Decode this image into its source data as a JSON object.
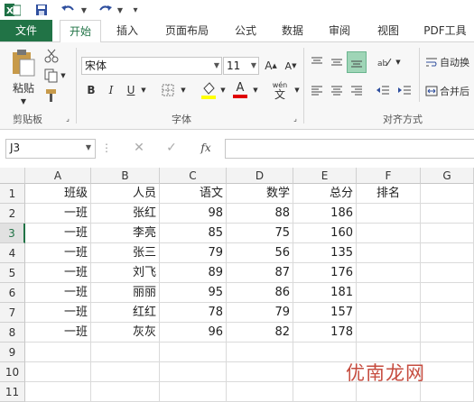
{
  "ribbon_tabs": [
    "文件",
    "开始",
    "插入",
    "页面布局",
    "公式",
    "数据",
    "审阅",
    "视图",
    "PDF工具"
  ],
  "active_tab": "开始",
  "clipboard": {
    "paste_label": "粘贴",
    "group_label": "剪贴板"
  },
  "font": {
    "name": "宋体",
    "size": "11",
    "group_label": "字体",
    "bold": "B",
    "italic": "I",
    "underline": "U",
    "font_color_label": "A",
    "wen_label": "wén",
    "wen_char": "文"
  },
  "alignment": {
    "group_label": "对齐方式",
    "wrap_label": "自动换",
    "merge_label": "合并后"
  },
  "formula_bar": {
    "cell_ref": "J3",
    "fx": "fx",
    "formula": ""
  },
  "columns": [
    "A",
    "B",
    "C",
    "D",
    "E",
    "F",
    "G"
  ],
  "rows": [
    [
      "班级",
      "人员",
      "语文",
      "数学",
      "总分",
      "排名",
      ""
    ],
    [
      "一班",
      "张红",
      "98",
      "88",
      "186",
      "",
      ""
    ],
    [
      "一班",
      "李亮",
      "85",
      "75",
      "160",
      "",
      ""
    ],
    [
      "一班",
      "张三",
      "79",
      "56",
      "135",
      "",
      ""
    ],
    [
      "一班",
      "刘飞",
      "89",
      "87",
      "176",
      "",
      ""
    ],
    [
      "一班",
      "丽丽",
      "95",
      "86",
      "181",
      "",
      ""
    ],
    [
      "一班",
      "红红",
      "78",
      "79",
      "157",
      "",
      ""
    ],
    [
      "一班",
      "灰灰",
      "96",
      "82",
      "178",
      "",
      ""
    ],
    [
      "",
      "",
      "",
      "",
      "",
      "",
      ""
    ],
    [
      "",
      "",
      "",
      "",
      "",
      "",
      ""
    ],
    [
      "",
      "",
      "",
      "",
      "",
      "",
      ""
    ]
  ],
  "row_numbers": [
    "1",
    "2",
    "3",
    "4",
    "5",
    "6",
    "7",
    "8",
    "9",
    "10",
    "11"
  ],
  "selected_row": 3,
  "watermark": "优南龙网"
}
